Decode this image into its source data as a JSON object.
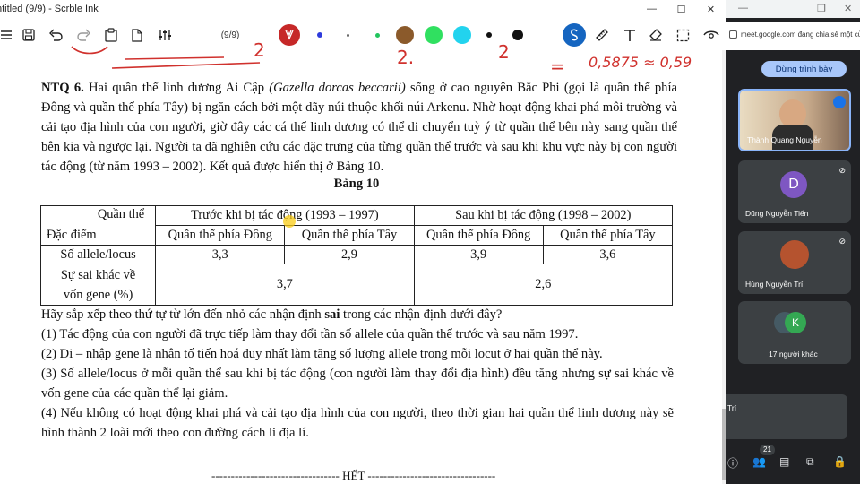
{
  "window": {
    "title": "ntitled (9/9) - Scrble Ink",
    "min": "—",
    "max": "☐",
    "close": "✕"
  },
  "toolbar": {
    "page_counter": "(9/9)",
    "colors": [
      "#c62828",
      "#2e3bdc",
      "#22c55e",
      "#8b5a2b",
      "#30e060",
      "#22d3ee",
      "#111111",
      "#111111",
      "#1565c0"
    ]
  },
  "document": {
    "heading": "NTQ 6.",
    "intro_1": " Hai quần thể linh dương Ai Cập ",
    "species": "(Gazella dorcas beccarii)",
    "intro_2": " sống ở cao nguyên Bắc Phi (gọi là quần thể phía Đông và quần thể phía Tây) bị ngăn cách bởi một dãy núi thuộc khối núi Arkenu. Nhờ hoạt động khai phá môi trường và cải tạo địa hình của con người, giờ đây các cá thể linh dương có thể di chuyển tuỳ ý từ quần thể bên này sang quần thể bên kia và ngược lại. Người ta đã nghiên cứu các đặc trưng của từng quần thể trước và sau khi khu vực này bị con người tác động (từ năm 1993 – 2002). Kết quả được hiển thị ở Bảng 10.",
    "table_title": "Bảng 10",
    "table": {
      "corner_top": "Quần thể",
      "corner_bottom": "Đặc điểm",
      "before": "Trước khi bị tác động (1993 – 1997)",
      "after": "Sau khi bị tác động (1998 – 2002)",
      "east": "Quần thể phía Đông",
      "west": "Quần thể phía Tây",
      "row1_label": "Số allele/locus",
      "row1": [
        "3,3",
        "2,9",
        "3,9",
        "3,6"
      ],
      "row2_label_a": "Sự sai khác về",
      "row2_label_b": "vốn gene (%)",
      "row2": [
        "3,7",
        "2,6"
      ]
    },
    "question_a": "Hãy sắp xếp theo thứ tự từ lớn đến nhỏ các nhận định ",
    "question_b": "sai",
    "question_c": " trong các nhận định dưới đây?",
    "s1": "(1) Tác động của con người đã trực tiếp làm thay đổi tần số allele của quần thể trước và sau năm 1997.",
    "s2": "(2) Di – nhập gene là nhân tố tiến hoá duy nhất làm tăng số lượng allele trong mỗi locut ở hai quần thể này.",
    "s3": "(3) Số allele/locus ở mỗi quần thể sau khi bị tác động (con người làm thay đổi địa hình) đều tăng nhưng sự sai khác về vốn gene của các quần thể lại giảm.",
    "s4": "(4) Nếu không có hoạt động khai phá và cải tạo địa hình của con người, theo thời gian hai quần thể linh dương này sẽ hình thành 2 loài mới theo con đường cách li địa lí.",
    "footer": "--------------------------------- HẾT ---------------------------------",
    "handwriting_1": "2",
    "handwriting_2": "2.",
    "handwriting_3": "2",
    "handwriting_4": "=",
    "handwriting_5": "0,5875 ≈ 0,59"
  },
  "meet": {
    "url": "meet.google.com đang chia sẻ một cửa",
    "stop_presenting": "Dừng trình bày",
    "tiles": [
      {
        "name": "Thành Quang Nguyễn"
      },
      {
        "name": "Dũng Nguyễn Tiến",
        "initial": "D"
      },
      {
        "name": "Hùng Nguyễn Trí"
      },
      {
        "name": "17 người khác",
        "initial": "K"
      }
    ],
    "self_tile_label": "Trí",
    "participant_count": "21"
  }
}
